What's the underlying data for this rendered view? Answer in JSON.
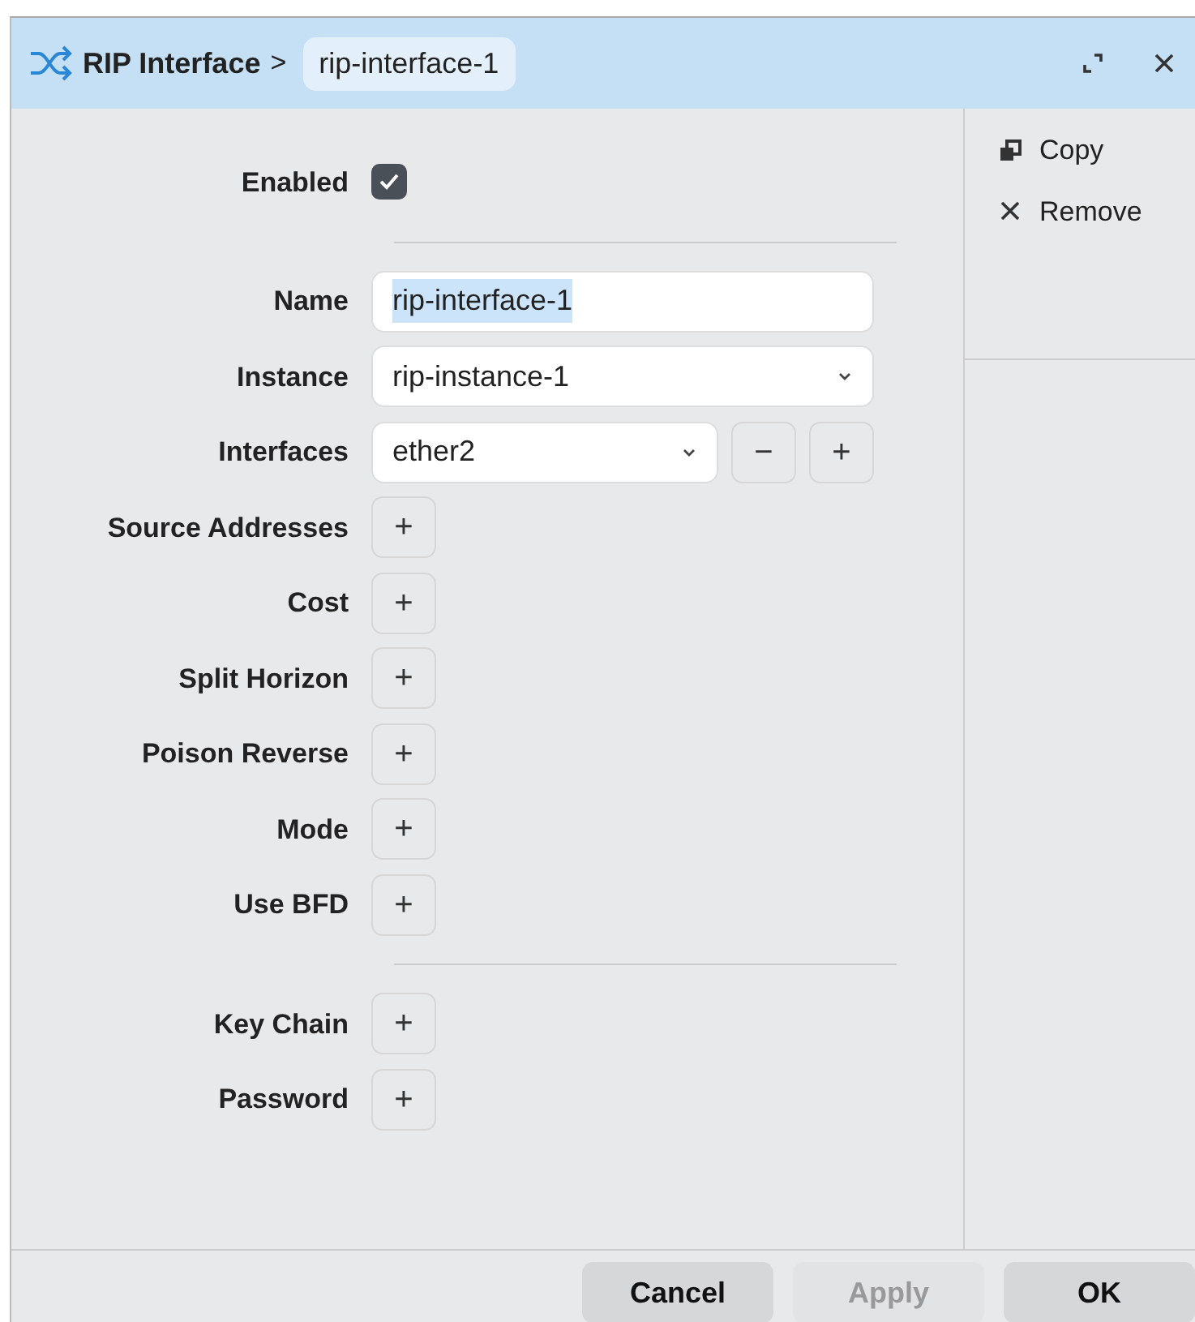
{
  "window": {
    "title": "RIP Interface",
    "separator": ">",
    "item": "rip-interface-1"
  },
  "sections": [
    {
      "fields": [
        {
          "label": "Enabled",
          "kind": "checkbox",
          "checked": true
        }
      ]
    },
    {
      "fields": [
        {
          "label": "Name",
          "kind": "text",
          "value": "rip-interface-1",
          "text_selected": true
        },
        {
          "label": "Instance",
          "kind": "select",
          "value": "rip-instance-1"
        },
        {
          "label": "Interfaces",
          "kind": "multi",
          "value": "ether2",
          "remove": "−",
          "add": "+"
        },
        {
          "label": "Source Addresses",
          "kind": "add",
          "add": "+"
        },
        {
          "label": "Cost",
          "kind": "add",
          "add": "+"
        },
        {
          "label": "Split Horizon",
          "kind": "add",
          "add": "+"
        },
        {
          "label": "Poison Reverse",
          "kind": "add",
          "add": "+"
        },
        {
          "label": "Mode",
          "kind": "add",
          "add": "+"
        },
        {
          "label": "Use BFD",
          "kind": "add",
          "add": "+"
        }
      ]
    },
    {
      "fields": [
        {
          "label": "Key Chain",
          "kind": "add",
          "add": "+"
        },
        {
          "label": "Password",
          "kind": "add",
          "add": "+"
        }
      ]
    }
  ],
  "actions": [
    {
      "label": "Copy",
      "kind": "copy"
    },
    {
      "label": "Remove",
      "kind": "remove"
    }
  ],
  "buttons": [
    {
      "label": "Cancel",
      "disabled": false
    },
    {
      "label": "Apply",
      "disabled": true
    },
    {
      "label": "OK",
      "disabled": false
    }
  ]
}
